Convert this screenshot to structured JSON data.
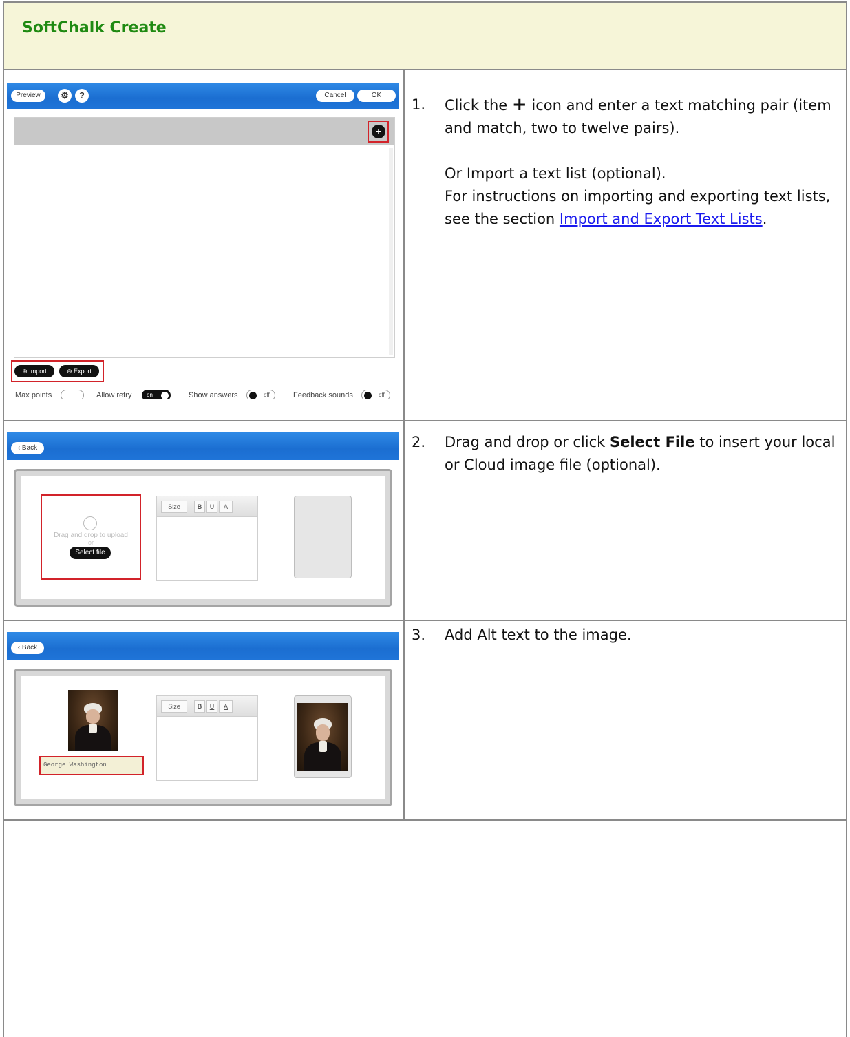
{
  "header": {
    "title": "SoftChalk Create"
  },
  "steps": [
    {
      "number": "1.",
      "line1_before": "Click the",
      "plus_glyph": "+",
      "line1_after": "icon and enter a text matching pair (item and match, two to twelve pairs).",
      "para2": "Or Import a text list (optional).",
      "para3_text": "For instructions on importing and exporting text lists, see the section",
      "para3_link": "Import and Export Text Lists",
      "para3_end": "."
    },
    {
      "number": "2.",
      "text_before": "Drag and drop or click",
      "bold": "Select File",
      "text_after": "to insert your local or Cloud image file (optional)."
    },
    {
      "number": "3.",
      "text": "Add Alt text to the image."
    }
  ],
  "shot1": {
    "preview_label": "Preview",
    "gear_glyph": "⚙",
    "help_glyph": "?",
    "cancel_label": "Cancel",
    "ok_label": "OK",
    "add_glyph": "+",
    "import_label": "⊕ Import",
    "export_label": "⊖ Export",
    "max_points_label": "Max points",
    "allow_retry_label": "Allow retry",
    "allow_retry_state": "on",
    "show_answers_label": "Show answers",
    "show_answers_state": "off",
    "feedback_sounds_label": "Feedback sounds",
    "feedback_sounds_state": "off"
  },
  "shot2": {
    "back_label": "‹ Back",
    "drop_text": "Drag and drop to upload",
    "or_text": "or",
    "select_file_label": "Select file",
    "size_label": "Size",
    "bold_label": "B",
    "underline_label": "U",
    "color_label": "A"
  },
  "shot3": {
    "back_label": "‹ Back",
    "alt_text_value": "George Washington",
    "size_label": "Size",
    "bold_label": "B",
    "underline_label": "U",
    "color_label": "A"
  }
}
